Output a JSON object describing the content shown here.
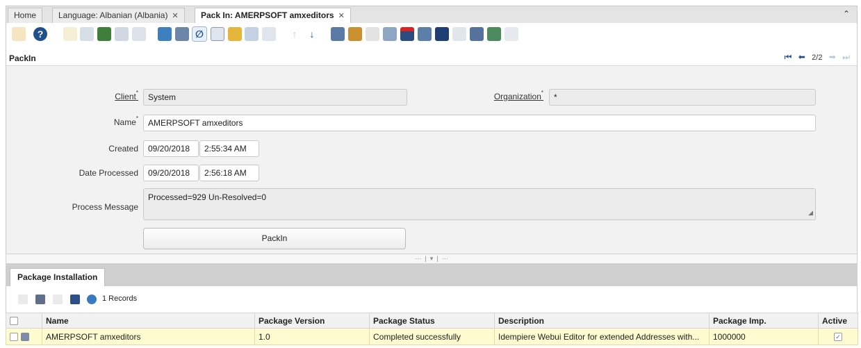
{
  "tabs": [
    {
      "label": "Home"
    },
    {
      "label": "Language: Albanian (Albania)"
    },
    {
      "label": "Pack In: AMERPSOFT amxeditors"
    }
  ],
  "window": {
    "title": "PackIn",
    "record_position": "2/2"
  },
  "form": {
    "client_label": "Client",
    "client_value": "System",
    "organization_label": "Organization",
    "organization_value": "*",
    "name_label": "Name",
    "name_value": "AMERPSOFT amxeditors",
    "created_label": "Created",
    "created_date": "09/20/2018",
    "created_time": "2:55:34 AM",
    "processed_label": "Date Processed",
    "processed_date": "09/20/2018",
    "processed_time": "2:56:18 AM",
    "message_label": "Process Message",
    "message_value": "Processed=929 Un-Resolved=0",
    "packin_button": "PackIn"
  },
  "detail": {
    "tab_label": "Package Installation",
    "record_count": "1 Records",
    "columns": [
      "Name",
      "Package Version",
      "Package Status",
      "Description",
      "Package Imp.",
      "Active"
    ],
    "rows": [
      {
        "name": "AMERPSOFT amxeditors",
        "version": "1.0",
        "status": "Completed successfully",
        "description": "Idempiere Webui Editor for extended Addresses with...",
        "imp": "1000000",
        "active": "✓"
      }
    ]
  },
  "colors": {
    "accent": "#1f4f8c",
    "row_highlight": "#fffbd1",
    "form_bg": "#f2f2f2"
  }
}
